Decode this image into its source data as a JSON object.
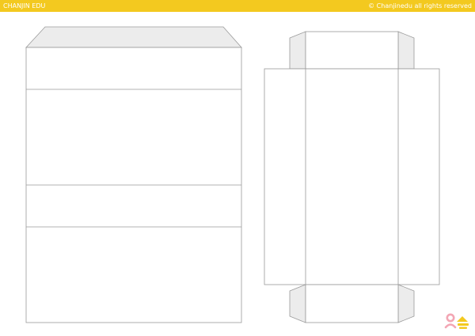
{
  "header": {
    "brand": "CHANJIN EDU",
    "copyright": "© Chanjinedu all rights reserved"
  },
  "colors": {
    "header_bar": "#f3c91f",
    "logo_pink": "#f3a6b4",
    "logo_yellow": "#f3c91f",
    "cut_line": "#9a9a9a",
    "flap_fill": "#ececec"
  },
  "logo": {
    "icon": "chanjin-logo-icon"
  }
}
